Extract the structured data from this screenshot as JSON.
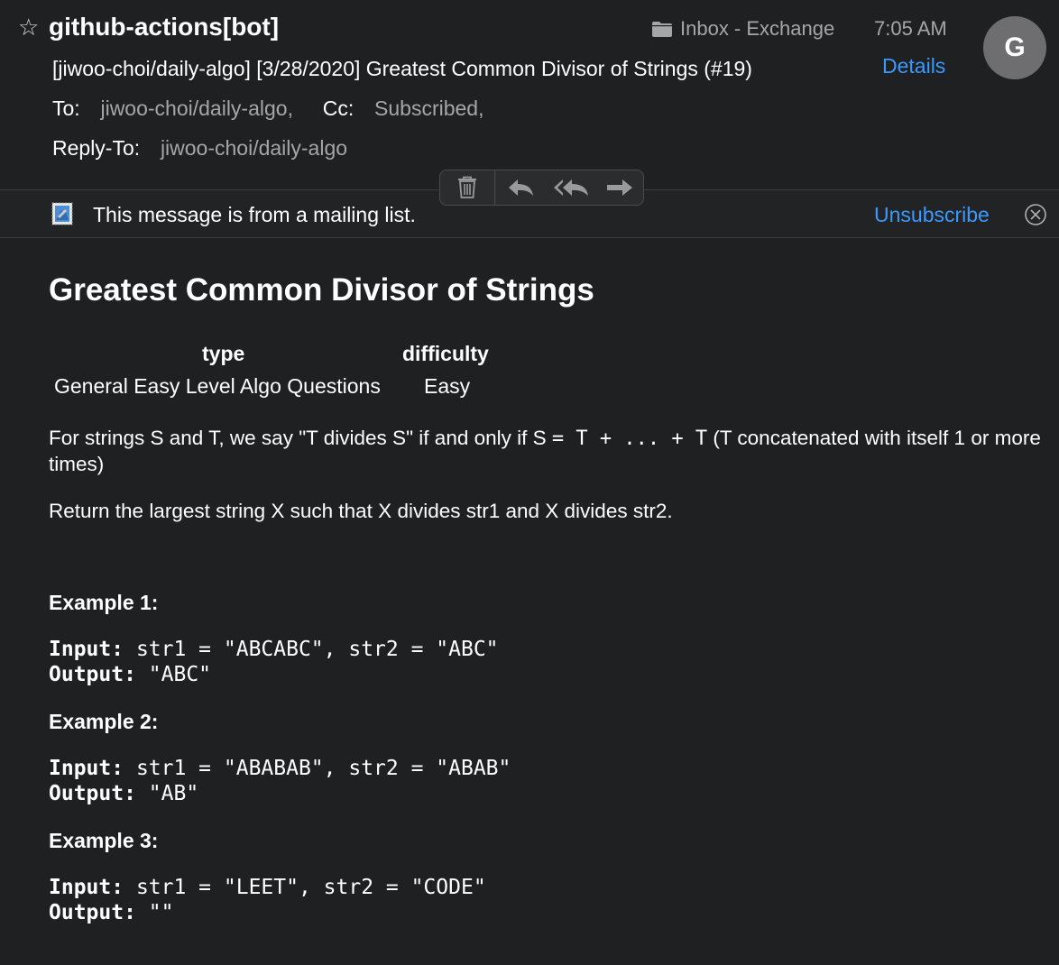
{
  "header": {
    "sender": "github-actions[bot]",
    "mailbox": "Inbox - Exchange",
    "time": "7:05 AM",
    "avatar_letter": "G",
    "subject": "[jiwoo-choi/daily-algo] [3/28/2020] Greatest Common Divisor of Strings (#19)",
    "details_label": "Details",
    "to_label": "To:",
    "to_value": "jiwoo-choi/daily-algo,",
    "cc_label": "Cc:",
    "cc_value": "Subscribed,",
    "reply_to_label": "Reply-To:",
    "reply_to_value": "jiwoo-choi/daily-algo"
  },
  "toolbar": {
    "icons": [
      "trash-icon",
      "reply-icon",
      "reply-all-icon",
      "forward-icon"
    ]
  },
  "banner": {
    "text": "This message is from a mailing list.",
    "unsubscribe_label": "Unsubscribe"
  },
  "body": {
    "title": "Greatest Common Divisor of Strings",
    "meta": {
      "type_header": "type",
      "difficulty_header": "difficulty",
      "type_value": "General Easy Level Algo Questions",
      "difficulty_value": "Easy"
    },
    "para1_before": "For strings S and T, we say \"T divides S\" if and only if S ",
    "para1_code": "= T + ... + T",
    "para1_after": " (T concatenated with itself 1 or more times)",
    "para2": "Return the largest string X such that X divides str1 and X divides str2.",
    "examples": [
      {
        "heading": "Example 1:",
        "input_label": "Input:",
        "input": " str1 = \"ABCABC\", str2 = \"ABC\"",
        "output_label": "Output:",
        "output": " \"ABC\""
      },
      {
        "heading": "Example 2:",
        "input_label": "Input:",
        "input": " str1 = \"ABABAB\", str2 = \"ABAB\"",
        "output_label": "Output:",
        "output": " \"AB\""
      },
      {
        "heading": "Example 3:",
        "input_label": "Input:",
        "input": " str1 = \"LEET\", str2 = \"CODE\"",
        "output_label": "Output:",
        "output": " \"\""
      }
    ]
  },
  "colors": {
    "background": "#1f2022",
    "link": "#3b99fc",
    "secondary_text": "#a6a6a6",
    "avatar": "#6e6e70"
  }
}
